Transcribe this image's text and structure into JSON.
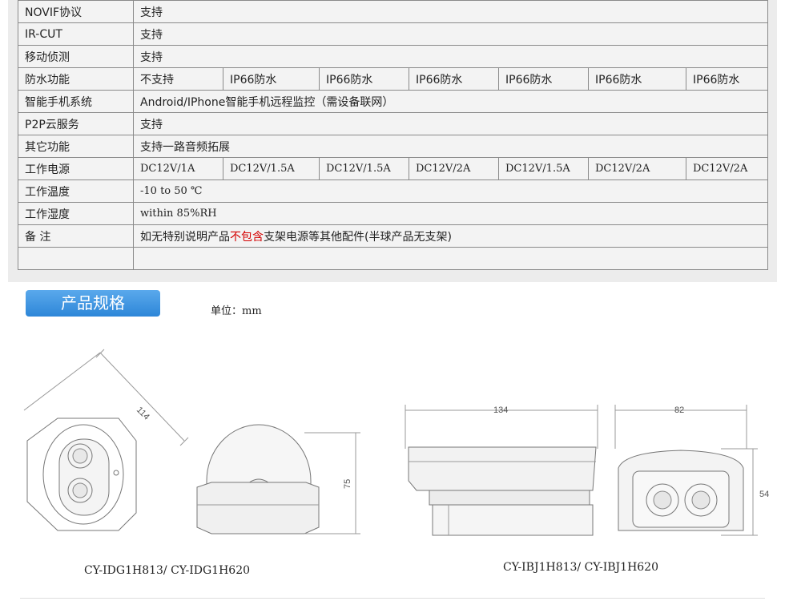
{
  "spec_rows": [
    {
      "label": "NOVIF协议",
      "value": "支持"
    },
    {
      "label": "IR-CUT",
      "value": "支持"
    },
    {
      "label": "移动侦测",
      "value": "支持"
    },
    {
      "label": "防水功能",
      "cells": [
        "不支持",
        "IP66防水",
        "IP66防水",
        "IP66防水",
        "IP66防水",
        "IP66防水",
        "IP66防水"
      ]
    },
    {
      "label": "智能手机系统",
      "value": "Android/IPhone智能手机远程监控（需设备联网）"
    },
    {
      "label": "P2P云服务",
      "value": "支持"
    },
    {
      "label": "其它功能",
      "value": "支持一路音频拓展"
    },
    {
      "label": "工作电源",
      "cells": [
        "DC12V/1A",
        "DC12V/1.5A",
        "DC12V/1.5A",
        "DC12V/2A",
        "DC12V/1.5A",
        "DC12V/2A",
        "DC12V/2A"
      ]
    },
    {
      "label": "工作温度",
      "value": "-10 to 50 ℃"
    },
    {
      "label": "工作湿度",
      "value": "within 85%RH"
    },
    {
      "label": "备 注",
      "note": {
        "before": "如无特别说明产品",
        "highlight": "不包含",
        "after": "支架电源等其他配件(半球产品无支架)"
      }
    },
    {
      "label": "",
      "value": ""
    }
  ],
  "section_title": "产品规格",
  "unit_label": "单位：mm",
  "dimensions": {
    "dome_diagonal": "114",
    "dome_height": "75",
    "bullet_length": "134",
    "bullet_width": "82",
    "bullet_height": "54"
  },
  "models": {
    "dome": "CY-IDG1H813/ CY-IDG1H620",
    "bullet": "CY-IBJ1H813/ CY-IBJ1H620"
  },
  "colors": {
    "highlight": "#d40000",
    "tag": "#3a93e0"
  }
}
